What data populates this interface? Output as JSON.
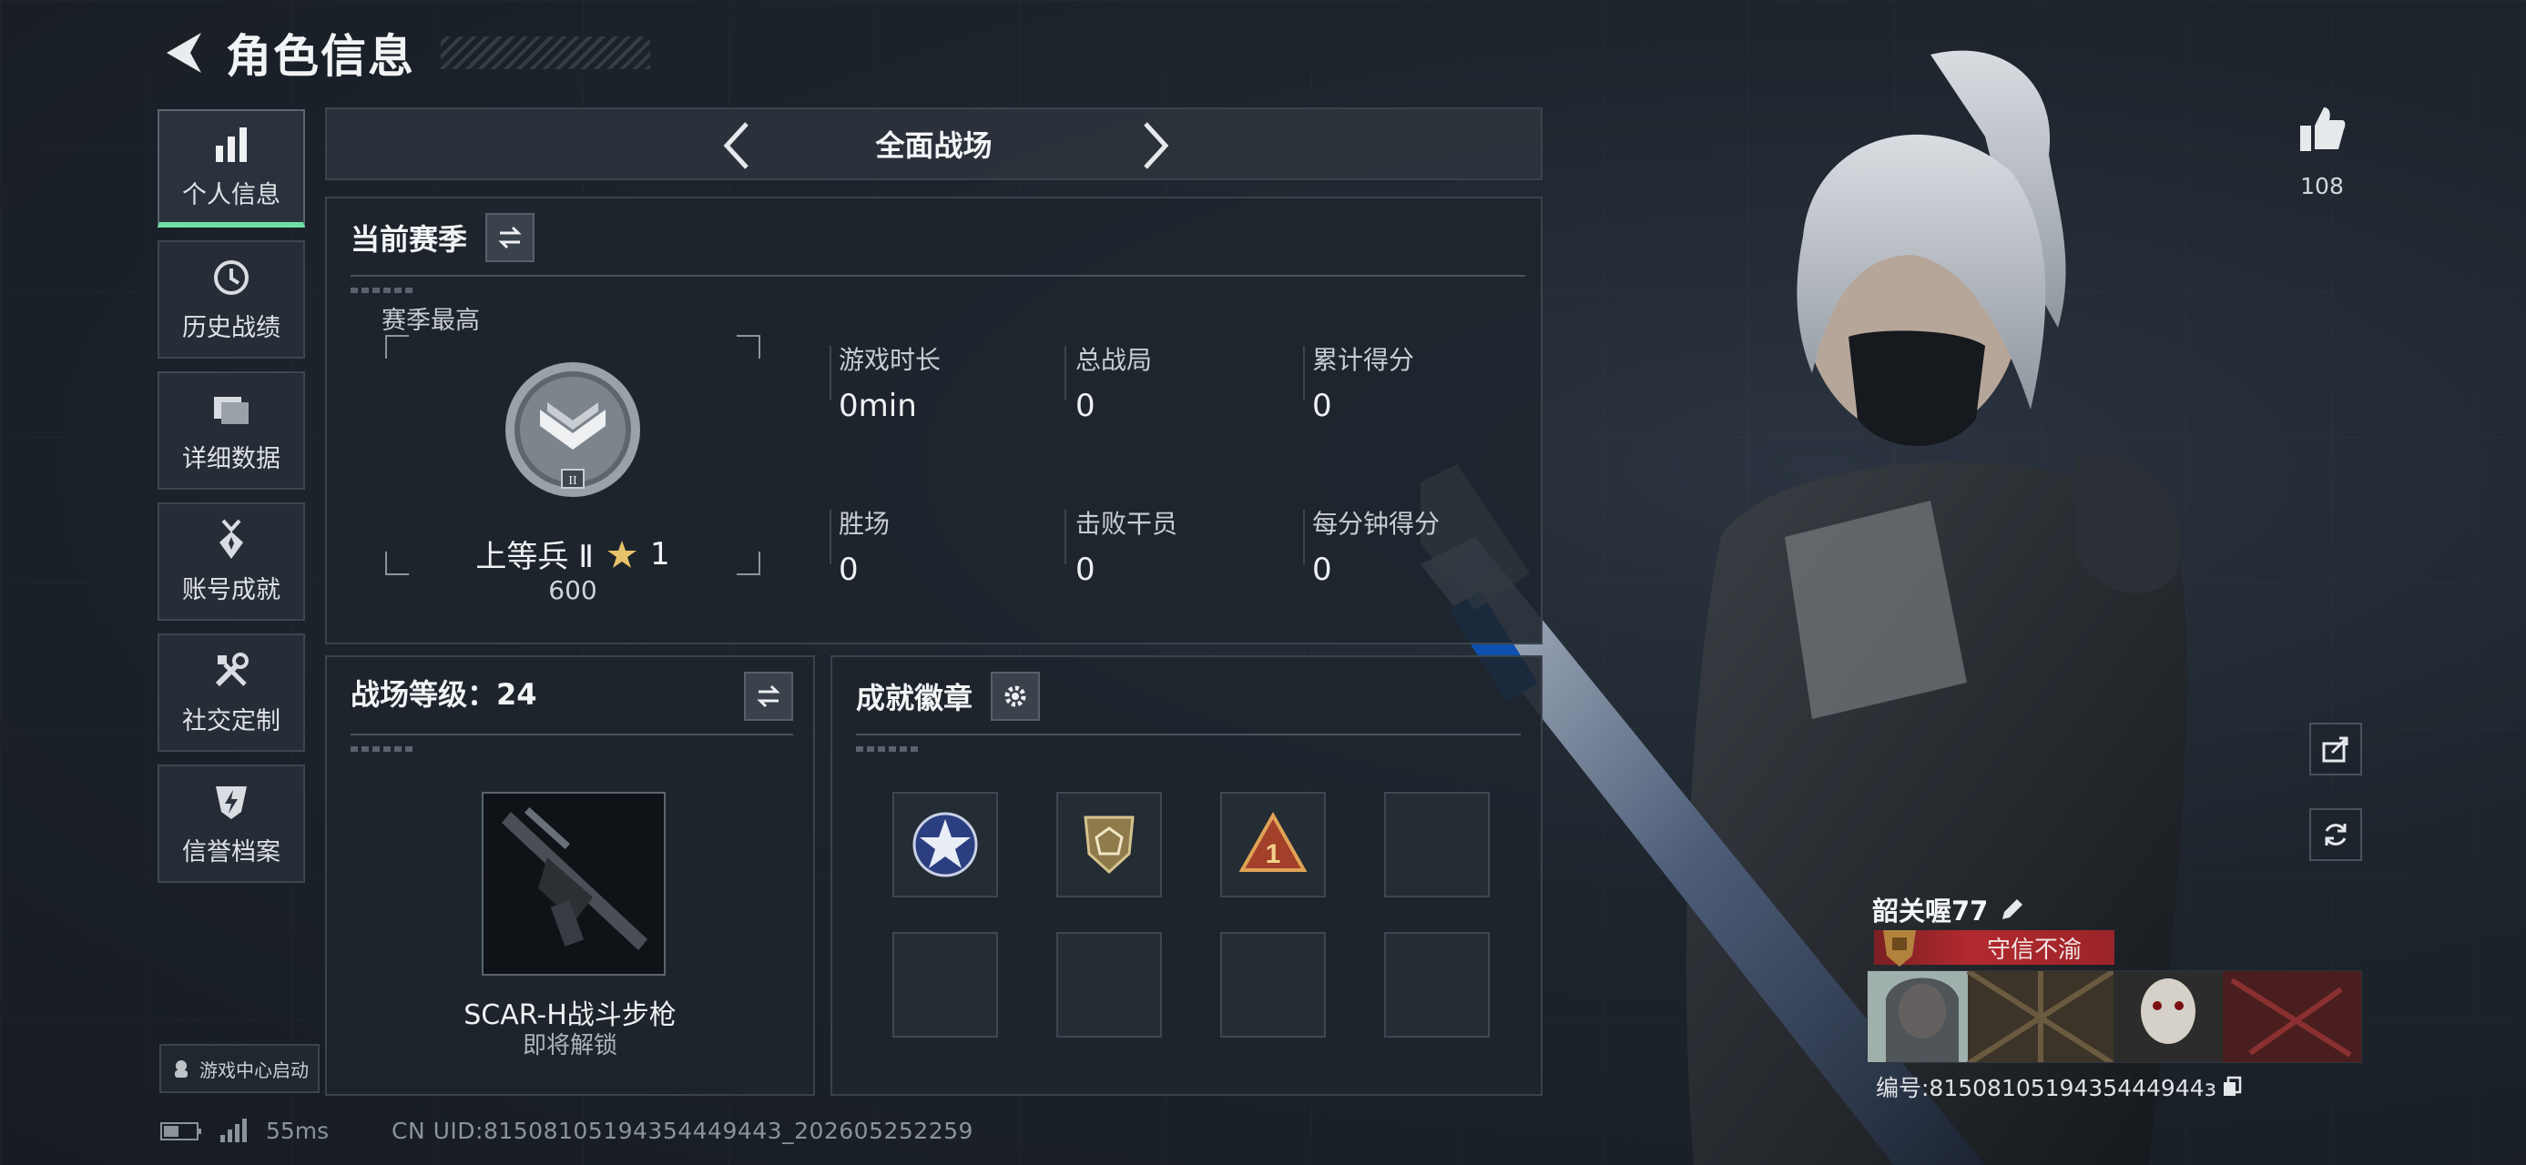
{
  "header": {
    "title": "角色信息"
  },
  "sidebar": {
    "items": [
      {
        "label": "个人信息",
        "icon": "bar-chart-icon",
        "active": true
      },
      {
        "label": "历史战绩",
        "icon": "history-clock-icon",
        "active": false
      },
      {
        "label": "详细数据",
        "icon": "folder-data-icon",
        "active": false
      },
      {
        "label": "账号成就",
        "icon": "medal-icon",
        "active": false
      },
      {
        "label": "社交定制",
        "icon": "tools-icon",
        "active": false
      },
      {
        "label": "信誉档案",
        "icon": "shield-bolt-icon",
        "active": false
      }
    ],
    "launch_label": "游戏中心启动"
  },
  "mode_bar": {
    "title": "全面战场"
  },
  "season": {
    "title": "当前赛季",
    "sub_label": "赛季最高",
    "rank_name": "上等兵 Ⅱ",
    "rank_stars": "1",
    "rank_score": "600",
    "rank_roman": "II",
    "stats": [
      {
        "label": "游戏时长",
        "value": "0min"
      },
      {
        "label": "总战局",
        "value": "0"
      },
      {
        "label": "累计得分",
        "value": "0"
      },
      {
        "label": "胜场",
        "value": "0"
      },
      {
        "label": "击败干员",
        "value": "0"
      },
      {
        "label": "每分钟得分",
        "value": "0"
      }
    ]
  },
  "level": {
    "title": "战场等级：24",
    "weapon_name": "SCAR-H战斗步枪",
    "weapon_status": "即将解锁"
  },
  "badges": {
    "title": "成就徽章",
    "slot_count": 8,
    "filled": [
      "star-emblem-icon",
      "d20-shield-icon",
      "triangle-one-icon"
    ]
  },
  "right": {
    "like_count": "108",
    "player_name": "韶关喔77",
    "player_title": "守信不渝",
    "uid_line": "编号:8150810519435444944з"
  },
  "status": {
    "ping": "55ms",
    "cn_uid": "CN UID:81508105194354449443_202605252259"
  },
  "colors": {
    "accent_green": "#6fe0a4",
    "title_red": "#b22a2f",
    "panel_bg": "#1e242c"
  }
}
